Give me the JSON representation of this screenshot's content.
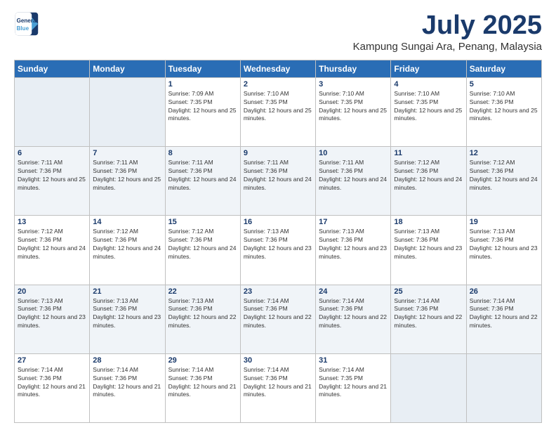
{
  "logo": {
    "line1": "General",
    "line2": "Blue"
  },
  "title": "July 2025",
  "location": "Kampung Sungai Ara, Penang, Malaysia",
  "days_of_week": [
    "Sunday",
    "Monday",
    "Tuesday",
    "Wednesday",
    "Thursday",
    "Friday",
    "Saturday"
  ],
  "weeks": [
    [
      {
        "day": "",
        "sunrise": "",
        "sunset": "",
        "daylight": ""
      },
      {
        "day": "",
        "sunrise": "",
        "sunset": "",
        "daylight": ""
      },
      {
        "day": "1",
        "sunrise": "Sunrise: 7:09 AM",
        "sunset": "Sunset: 7:35 PM",
        "daylight": "Daylight: 12 hours and 25 minutes."
      },
      {
        "day": "2",
        "sunrise": "Sunrise: 7:10 AM",
        "sunset": "Sunset: 7:35 PM",
        "daylight": "Daylight: 12 hours and 25 minutes."
      },
      {
        "day": "3",
        "sunrise": "Sunrise: 7:10 AM",
        "sunset": "Sunset: 7:35 PM",
        "daylight": "Daylight: 12 hours and 25 minutes."
      },
      {
        "day": "4",
        "sunrise": "Sunrise: 7:10 AM",
        "sunset": "Sunset: 7:35 PM",
        "daylight": "Daylight: 12 hours and 25 minutes."
      },
      {
        "day": "5",
        "sunrise": "Sunrise: 7:10 AM",
        "sunset": "Sunset: 7:36 PM",
        "daylight": "Daylight: 12 hours and 25 minutes."
      }
    ],
    [
      {
        "day": "6",
        "sunrise": "Sunrise: 7:11 AM",
        "sunset": "Sunset: 7:36 PM",
        "daylight": "Daylight: 12 hours and 25 minutes."
      },
      {
        "day": "7",
        "sunrise": "Sunrise: 7:11 AM",
        "sunset": "Sunset: 7:36 PM",
        "daylight": "Daylight: 12 hours and 25 minutes."
      },
      {
        "day": "8",
        "sunrise": "Sunrise: 7:11 AM",
        "sunset": "Sunset: 7:36 PM",
        "daylight": "Daylight: 12 hours and 24 minutes."
      },
      {
        "day": "9",
        "sunrise": "Sunrise: 7:11 AM",
        "sunset": "Sunset: 7:36 PM",
        "daylight": "Daylight: 12 hours and 24 minutes."
      },
      {
        "day": "10",
        "sunrise": "Sunrise: 7:11 AM",
        "sunset": "Sunset: 7:36 PM",
        "daylight": "Daylight: 12 hours and 24 minutes."
      },
      {
        "day": "11",
        "sunrise": "Sunrise: 7:12 AM",
        "sunset": "Sunset: 7:36 PM",
        "daylight": "Daylight: 12 hours and 24 minutes."
      },
      {
        "day": "12",
        "sunrise": "Sunrise: 7:12 AM",
        "sunset": "Sunset: 7:36 PM",
        "daylight": "Daylight: 12 hours and 24 minutes."
      }
    ],
    [
      {
        "day": "13",
        "sunrise": "Sunrise: 7:12 AM",
        "sunset": "Sunset: 7:36 PM",
        "daylight": "Daylight: 12 hours and 24 minutes."
      },
      {
        "day": "14",
        "sunrise": "Sunrise: 7:12 AM",
        "sunset": "Sunset: 7:36 PM",
        "daylight": "Daylight: 12 hours and 24 minutes."
      },
      {
        "day": "15",
        "sunrise": "Sunrise: 7:12 AM",
        "sunset": "Sunset: 7:36 PM",
        "daylight": "Daylight: 12 hours and 24 minutes."
      },
      {
        "day": "16",
        "sunrise": "Sunrise: 7:13 AM",
        "sunset": "Sunset: 7:36 PM",
        "daylight": "Daylight: 12 hours and 23 minutes."
      },
      {
        "day": "17",
        "sunrise": "Sunrise: 7:13 AM",
        "sunset": "Sunset: 7:36 PM",
        "daylight": "Daylight: 12 hours and 23 minutes."
      },
      {
        "day": "18",
        "sunrise": "Sunrise: 7:13 AM",
        "sunset": "Sunset: 7:36 PM",
        "daylight": "Daylight: 12 hours and 23 minutes."
      },
      {
        "day": "19",
        "sunrise": "Sunrise: 7:13 AM",
        "sunset": "Sunset: 7:36 PM",
        "daylight": "Daylight: 12 hours and 23 minutes."
      }
    ],
    [
      {
        "day": "20",
        "sunrise": "Sunrise: 7:13 AM",
        "sunset": "Sunset: 7:36 PM",
        "daylight": "Daylight: 12 hours and 23 minutes."
      },
      {
        "day": "21",
        "sunrise": "Sunrise: 7:13 AM",
        "sunset": "Sunset: 7:36 PM",
        "daylight": "Daylight: 12 hours and 23 minutes."
      },
      {
        "day": "22",
        "sunrise": "Sunrise: 7:13 AM",
        "sunset": "Sunset: 7:36 PM",
        "daylight": "Daylight: 12 hours and 22 minutes."
      },
      {
        "day": "23",
        "sunrise": "Sunrise: 7:14 AM",
        "sunset": "Sunset: 7:36 PM",
        "daylight": "Daylight: 12 hours and 22 minutes."
      },
      {
        "day": "24",
        "sunrise": "Sunrise: 7:14 AM",
        "sunset": "Sunset: 7:36 PM",
        "daylight": "Daylight: 12 hours and 22 minutes."
      },
      {
        "day": "25",
        "sunrise": "Sunrise: 7:14 AM",
        "sunset": "Sunset: 7:36 PM",
        "daylight": "Daylight: 12 hours and 22 minutes."
      },
      {
        "day": "26",
        "sunrise": "Sunrise: 7:14 AM",
        "sunset": "Sunset: 7:36 PM",
        "daylight": "Daylight: 12 hours and 22 minutes."
      }
    ],
    [
      {
        "day": "27",
        "sunrise": "Sunrise: 7:14 AM",
        "sunset": "Sunset: 7:36 PM",
        "daylight": "Daylight: 12 hours and 21 minutes."
      },
      {
        "day": "28",
        "sunrise": "Sunrise: 7:14 AM",
        "sunset": "Sunset: 7:36 PM",
        "daylight": "Daylight: 12 hours and 21 minutes."
      },
      {
        "day": "29",
        "sunrise": "Sunrise: 7:14 AM",
        "sunset": "Sunset: 7:36 PM",
        "daylight": "Daylight: 12 hours and 21 minutes."
      },
      {
        "day": "30",
        "sunrise": "Sunrise: 7:14 AM",
        "sunset": "Sunset: 7:36 PM",
        "daylight": "Daylight: 12 hours and 21 minutes."
      },
      {
        "day": "31",
        "sunrise": "Sunrise: 7:14 AM",
        "sunset": "Sunset: 7:35 PM",
        "daylight": "Daylight: 12 hours and 21 minutes."
      },
      {
        "day": "",
        "sunrise": "",
        "sunset": "",
        "daylight": ""
      },
      {
        "day": "",
        "sunrise": "",
        "sunset": "",
        "daylight": ""
      }
    ]
  ]
}
